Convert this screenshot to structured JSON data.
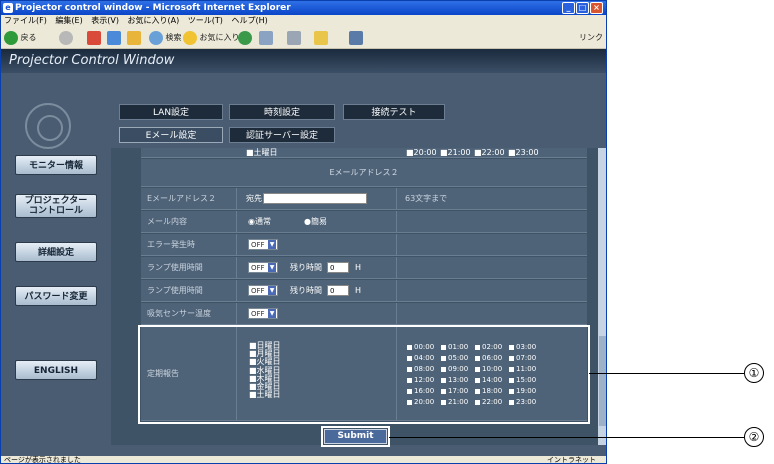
{
  "window_title": "Projector control window - Microsoft Internet Explorer",
  "menu": [
    "ファイル(F)",
    "編集(E)",
    "表示(V)",
    "お気に入り(A)",
    "ツール(T)",
    "ヘルプ(H)"
  ],
  "toolbar": {
    "back": "戻る",
    "search": "検索",
    "favorites": "お気に入り",
    "links": "リンク"
  },
  "brand": "Projector Control Window",
  "tabs": {
    "lan": "LAN設定",
    "time": "時刻設定",
    "conn": "接続テスト",
    "email": "Eメール設定",
    "auth": "認証サーバー設定"
  },
  "nav": {
    "monitor": "モニター情報",
    "projector1": "プロジェクター",
    "projector2": "コントロール",
    "detail": "詳細設定",
    "password": "パスワード変更",
    "english": "ENGLISH"
  },
  "top_rows": {
    "day": "■土曜日",
    "times": [
      "■20:00",
      "■21:00",
      "■22:00",
      "■23:00"
    ]
  },
  "section_header": "Eメールアドレス２",
  "rows": {
    "email2": {
      "label": "Eメールアドレス２",
      "to": "宛先",
      "note": "63文字まで"
    },
    "content": {
      "label": "メール内容",
      "opt1": "通常",
      "opt2": "簡易"
    },
    "error": {
      "label": "エラー発生時",
      "select": "OFF"
    },
    "lamp1": {
      "label": "ランプ使用時間",
      "select": "OFF",
      "remain": "残り時間",
      "value": "0",
      "unit": "H"
    },
    "lamp2": {
      "label": "ランプ使用時間",
      "select": "OFF",
      "remain": "残り時間",
      "value": "0",
      "unit": "H"
    },
    "intake": {
      "label": "吸気センサー温度",
      "select": "OFF"
    }
  },
  "periodic": {
    "label": "定期報告",
    "days": [
      "■日曜日",
      "■月曜日",
      "■火曜日",
      "■水曜日",
      "■木曜日",
      "■金曜日",
      "■土曜日"
    ],
    "times": [
      [
        "00:00",
        "01:00",
        "02:00",
        "03:00"
      ],
      [
        "04:00",
        "05:00",
        "06:00",
        "07:00"
      ],
      [
        "08:00",
        "09:00",
        "10:00",
        "11:00"
      ],
      [
        "12:00",
        "13:00",
        "14:00",
        "15:00"
      ],
      [
        "16:00",
        "17:00",
        "18:00",
        "19:00"
      ],
      [
        "20:00",
        "21:00",
        "22:00",
        "23:00"
      ]
    ]
  },
  "submit": "Submit",
  "status": {
    "left": "ページが表示されました",
    "right": "イントラネット"
  },
  "callouts": [
    "①",
    "②"
  ]
}
